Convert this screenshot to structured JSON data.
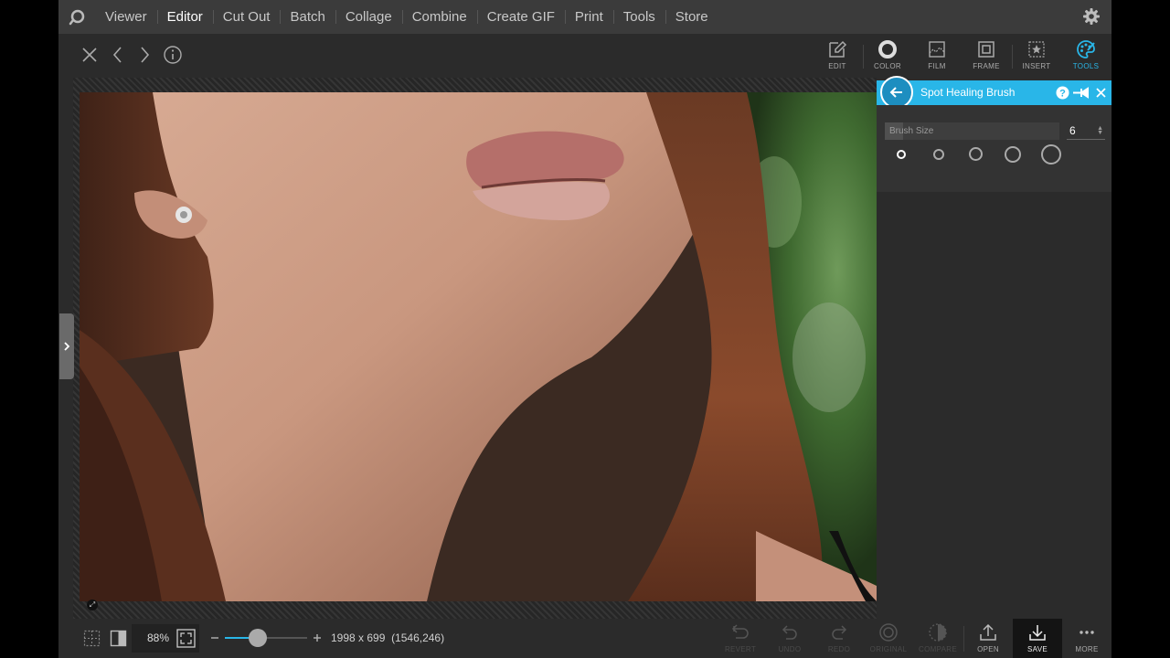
{
  "menu": {
    "items": [
      {
        "label": "Viewer",
        "active": false
      },
      {
        "label": "Editor",
        "active": true
      },
      {
        "label": "Cut Out",
        "active": false
      },
      {
        "label": "Batch",
        "active": false
      },
      {
        "label": "Collage",
        "active": false
      },
      {
        "label": "Combine",
        "active": false
      },
      {
        "label": "Create GIF",
        "active": false
      },
      {
        "label": "Print",
        "active": false
      },
      {
        "label": "Tools",
        "active": false
      },
      {
        "label": "Store",
        "active": false
      }
    ]
  },
  "tools": {
    "edit": "EDIT",
    "color": "COLOR",
    "film": "FILM",
    "frame": "FRAME",
    "insert": "INSERT",
    "tools": "TOOLS"
  },
  "panel": {
    "title": "Spot Healing Brush",
    "brush_size_label": "Brush Size",
    "brush_size_value": "6"
  },
  "status": {
    "zoom": "88%",
    "zoom_fraction": 0.4,
    "dimensions": "1998 x 699",
    "cursor_position": "(1546,246)"
  },
  "actions": {
    "revert": "REVERT",
    "undo": "UNDO",
    "redo": "REDO",
    "original": "ORIGINAL",
    "compare": "COMPARE",
    "open": "OPEN",
    "save": "SAVE",
    "more": "MORE"
  },
  "colors": {
    "accent": "#29b6e8",
    "menubar": "#3b3b3b",
    "background": "#2b2b2b"
  },
  "icons": {
    "logo": "app-logo-icon",
    "settings": "gear-icon",
    "close": "close-icon",
    "prev": "chevron-left-icon",
    "next": "chevron-right-icon",
    "info": "info-icon"
  }
}
